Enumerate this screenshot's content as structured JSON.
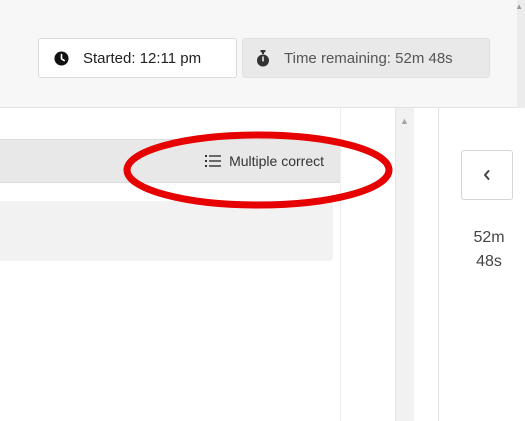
{
  "header": {
    "started_label": "Started: 12:11 pm",
    "time_remaining_label": "Time remaining: 52m 48s"
  },
  "question": {
    "type_label": "Multiple correct"
  },
  "side_panel": {
    "timer_minutes": "52m",
    "timer_seconds": "48s"
  },
  "icons": {
    "started": "clock-icon",
    "remaining": "stopwatch-icon",
    "question_type": "list-icon",
    "collapse": "chevron-left-icon"
  },
  "colors": {
    "annotation": "#e60000",
    "header_bg": "#f7f7f7",
    "question_header_bg": "#e8e8e8",
    "answer_bg": "#f2f2f2"
  }
}
